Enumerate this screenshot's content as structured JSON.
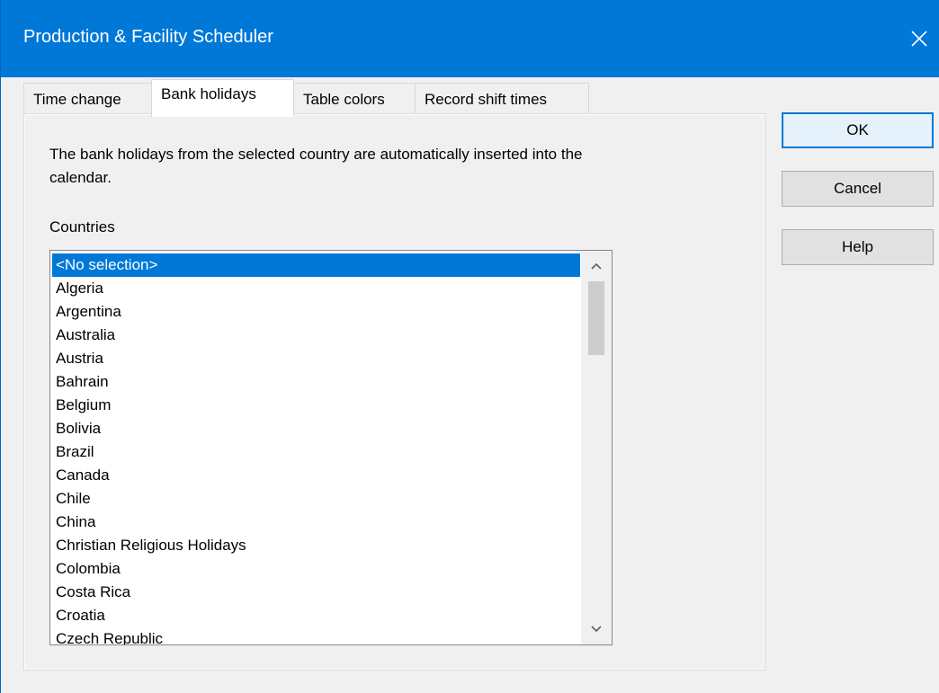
{
  "window": {
    "title": "Production & Facility Scheduler",
    "accent_color": "#0078d7",
    "close_icon": "close-icon"
  },
  "tabs": [
    {
      "label": "Time change",
      "active": false
    },
    {
      "label": "Bank holidays",
      "active": true
    },
    {
      "label": "Table colors",
      "active": false
    },
    {
      "label": "Record shift times",
      "active": false
    }
  ],
  "panel": {
    "description": "The bank holidays from the selected country are automatically inserted into the calendar.",
    "countries_label": "Countries",
    "countries": [
      "<No selection>",
      "Algeria",
      "Argentina",
      "Australia",
      "Austria",
      "Bahrain",
      "Belgium",
      "Bolivia",
      "Brazil",
      "Canada",
      "Chile",
      "China",
      "Christian Religious Holidays",
      "Colombia",
      "Costa Rica",
      "Croatia",
      "Czech Republic"
    ],
    "selected_index": 0
  },
  "buttons": {
    "ok": "OK",
    "cancel": "Cancel",
    "help": "Help"
  }
}
